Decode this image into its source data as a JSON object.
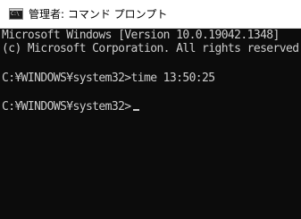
{
  "window": {
    "title": "管理者: コマンド プロンプト",
    "icon": "command-prompt-icon",
    "icon_glyph": "C:\\"
  },
  "console": {
    "lines": [
      "Microsoft Windows [Version 10.0.19042.1348]",
      "(c) Microsoft Corporation. All rights reserved.",
      "C:¥WINDOWS¥system32>time 13:50:25",
      "C:¥WINDOWS¥system32>"
    ],
    "cursor": "_"
  },
  "colors": {
    "console_background": "#0c0c0c",
    "console_text": "#cccccc",
    "titlebar_background": "#ffffff"
  }
}
